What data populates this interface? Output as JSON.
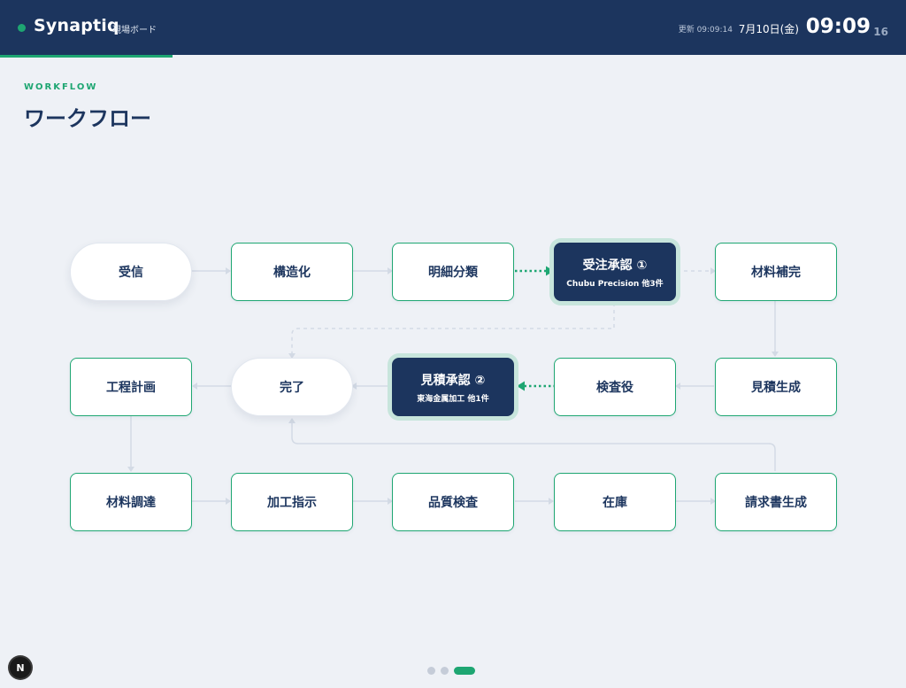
{
  "header": {
    "brand": "Synaptiq",
    "subtitle": "現場ボード",
    "updated": "更新 09:09:14",
    "date": "7月10日(金)",
    "time": "09:09",
    "seconds": "16"
  },
  "section": {
    "label": "WORKFLOW",
    "title": "ワークフロー"
  },
  "workflow": {
    "nodes": [
      {
        "label": "受信"
      },
      {
        "label": "構造化"
      },
      {
        "label": "明細分類"
      },
      {
        "label": "受注承認 ①",
        "sub": "Chubu Precision 他3件"
      },
      {
        "label": "材料補完"
      },
      {
        "label": "工程計画"
      },
      {
        "label": "完了"
      },
      {
        "label": "見積承認 ②",
        "sub": "東海金属加工 他1件"
      },
      {
        "label": "検査役"
      },
      {
        "label": "見積生成"
      },
      {
        "label": "材料調達"
      },
      {
        "label": "加工指示"
      },
      {
        "label": "品質検査"
      },
      {
        "label": "在庫"
      },
      {
        "label": "請求書生成"
      }
    ]
  },
  "pager": {
    "pages": 3,
    "active": 3
  },
  "badge": {
    "letter": "N"
  },
  "colors": {
    "navy": "#1c355e",
    "accent": "#1ea672",
    "background": "#eef1f6",
    "connector": "#d3dae5",
    "highlight_ring": "#c7e5dc"
  }
}
